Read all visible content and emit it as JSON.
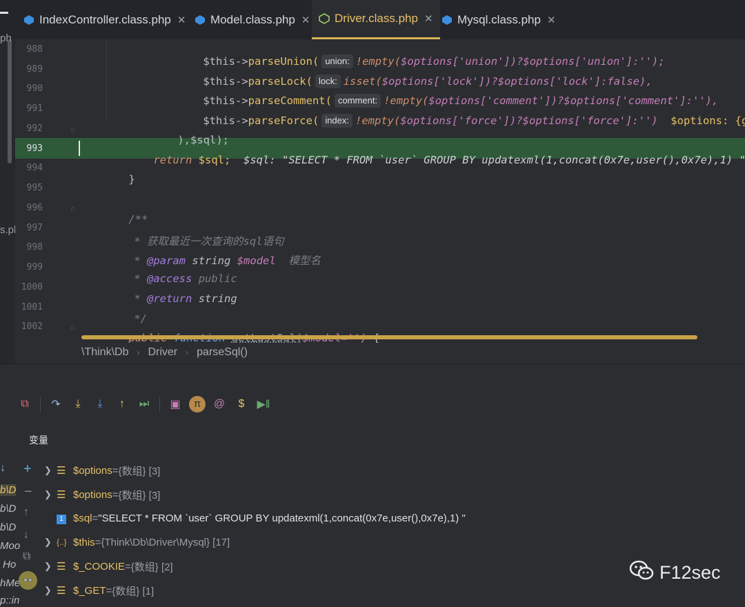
{
  "tabs": [
    {
      "label": "IndexController.class.php",
      "icon": "php-class-icon"
    },
    {
      "label": "Model.class.php",
      "icon": "php-class-icon"
    },
    {
      "label": "Driver.class.php",
      "icon": "php-abstract-class-icon",
      "active": true
    },
    {
      "label": "Mysql.class.php",
      "icon": "php-class-icon"
    }
  ],
  "left_clip": [
    "ph",
    "s.pl"
  ],
  "lines": [
    "988",
    "989",
    "990",
    "991",
    "992",
    "993",
    "994",
    "995",
    "996",
    "997",
    "998",
    "999",
    "1000",
    "1001",
    "1002"
  ],
  "code": {
    "l988_a": "$this->",
    "l988_b": "parseUnion(",
    "l988_h": "union:",
    "l988_c": "!empty(",
    "l988_d": "$options['union'])?",
    "l988_e": "$options['union']:'');",
    "l989_a": "$this->",
    "l989_b": "parseLock(",
    "l989_h": "lock:",
    "l989_c": "isset(",
    "l989_d": "$options['lock'])?",
    "l989_e": "$options['lock']:false),",
    "l990_a": "$this->",
    "l990_b": "parseComment(",
    "l990_h": "comment:",
    "l990_c": "!empty(",
    "l990_d": "$options['comment'])?",
    "l990_e": "$options['comment']:''),",
    "l991_a": "$this->",
    "l991_b": "parseForce(",
    "l991_h": "index:",
    "l991_c": "!empty(",
    "l991_d": "$options['force'])?",
    "l991_e": "$options['force']:'')",
    "l991_f": "$options: {group =>",
    "l992": "),$sql);",
    "l993_a": "return",
    "l993_b": "$sql;",
    "l993_c": "$sql: \"SELECT * FROM `user` GROUP BY updatexml(1,concat(0x7e,user(),0x7e),1) \"",
    "l994": "}",
    "l996": "/**",
    "l997": "* 获取最近一次查询的sql语句",
    "l998_a": "*",
    "l998_b": "@param",
    "l998_c": "string",
    "l998_d": "$model",
    "l998_e": "模型名",
    "l999_a": "*",
    "l999_b": "@access",
    "l999_c": "public",
    "l1000_a": "*",
    "l1000_b": "@return",
    "l1000_c": "string",
    "l1001": "*/",
    "l1002_a": "public",
    "l1002_b": "function",
    "l1002_c": "getLastSql(",
    "l1002_d": "$model='')",
    "l1002_e": "{"
  },
  "breadcrumb": [
    "\\Think\\Db",
    "Driver",
    "parseSql()"
  ],
  "debug": {
    "section_label": "变量",
    "variables": [
      {
        "name": "$options",
        "eq": " = ",
        "type": "{数组} [3]",
        "icon": "array-icon",
        "expandable": true
      },
      {
        "name": "$options",
        "eq": " = ",
        "type": "{数组} [3]",
        "icon": "array-icon",
        "expandable": true
      },
      {
        "name": "$sql",
        "eq": " = ",
        "value": "\"SELECT * FROM `user` GROUP BY updatexml(1,concat(0x7e,user(),0x7e),1) \"",
        "icon": "string-icon",
        "expandable": false
      },
      {
        "name": "$this",
        "eq": " = ",
        "type": "{Think\\Db\\Driver\\Mysql} [17]",
        "icon": "object-icon",
        "expandable": true
      },
      {
        "name": "$_COOKIE",
        "eq": " = ",
        "type": "{数组} [2]",
        "icon": "array-icon",
        "expandable": true
      },
      {
        "name": "$_GET",
        "eq": " = ",
        "type": "{数组} [1]",
        "icon": "array-icon",
        "expandable": true
      }
    ],
    "frames_clip": [
      "b\\D",
      "b\\D",
      "b\\D",
      "Moo",
      "Ho",
      "hMe",
      "p::in"
    ]
  },
  "watermark": "F12sec",
  "colors": {
    "accent": "#e8c069",
    "highlight": "#2e5a3a"
  }
}
